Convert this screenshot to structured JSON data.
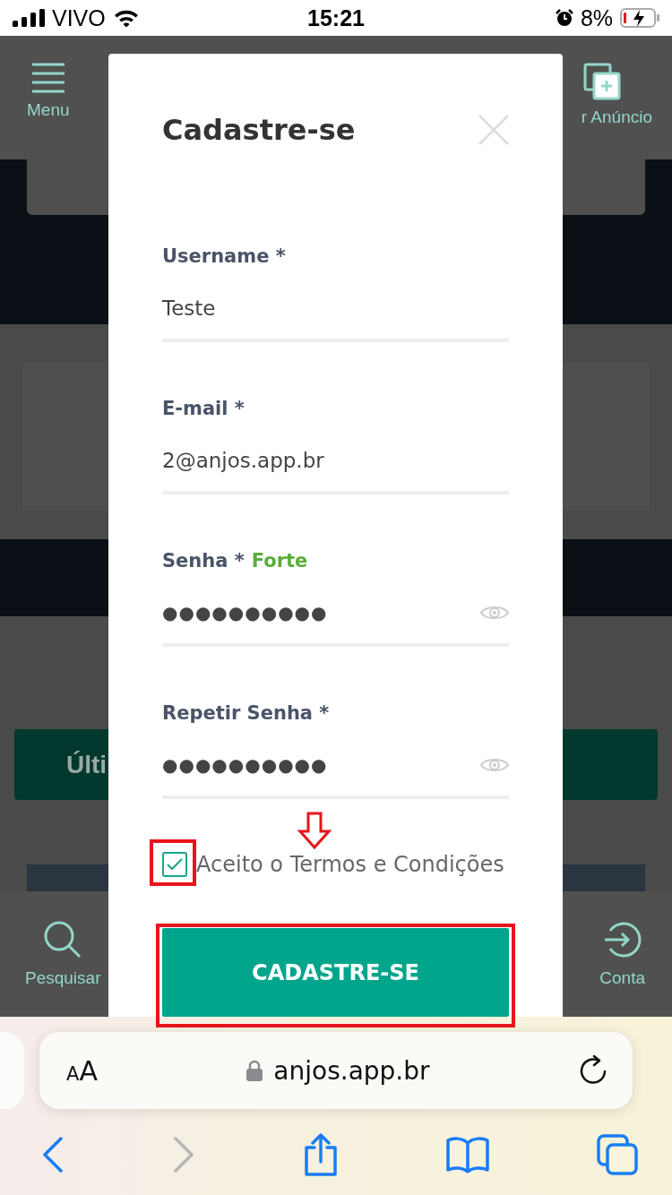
{
  "status_bar": {
    "carrier": "VIVO",
    "time": "15:21",
    "battery": "8%"
  },
  "background_page": {
    "menu_label": "Menu",
    "action_label": "r Anúncio",
    "banner": "Últi",
    "bottom_nav": [
      {
        "kind": "search",
        "label": "Pesquisar"
      },
      {
        "kind": "login",
        "label": "Conta"
      }
    ]
  },
  "dialog": {
    "title": "Cadastre-se",
    "fields": [
      {
        "kind": "text",
        "label": "Username *",
        "value": "Teste"
      },
      {
        "kind": "text",
        "label": "E-mail *",
        "value": "2@anjos.app.br"
      },
      {
        "kind": "password",
        "label": "Senha *",
        "strength": "Forte",
        "value": "●●●●●●●●●●"
      },
      {
        "kind": "password",
        "label": "Repetir Senha *",
        "value": "●●●●●●●●●●"
      }
    ],
    "terms": {
      "label": "Aceito o Termos e Condições",
      "checked": true
    },
    "submit": "CADASTRE-SE"
  },
  "browser": {
    "text_size": "AA",
    "url": "anjos.app.br",
    "toolbar": [
      {
        "kind": "back",
        "disabled": false
      },
      {
        "kind": "forward",
        "disabled": true
      },
      {
        "kind": "share",
        "disabled": false
      },
      {
        "kind": "bookmarks",
        "disabled": false
      },
      {
        "kind": "tabs",
        "disabled": false
      }
    ]
  }
}
